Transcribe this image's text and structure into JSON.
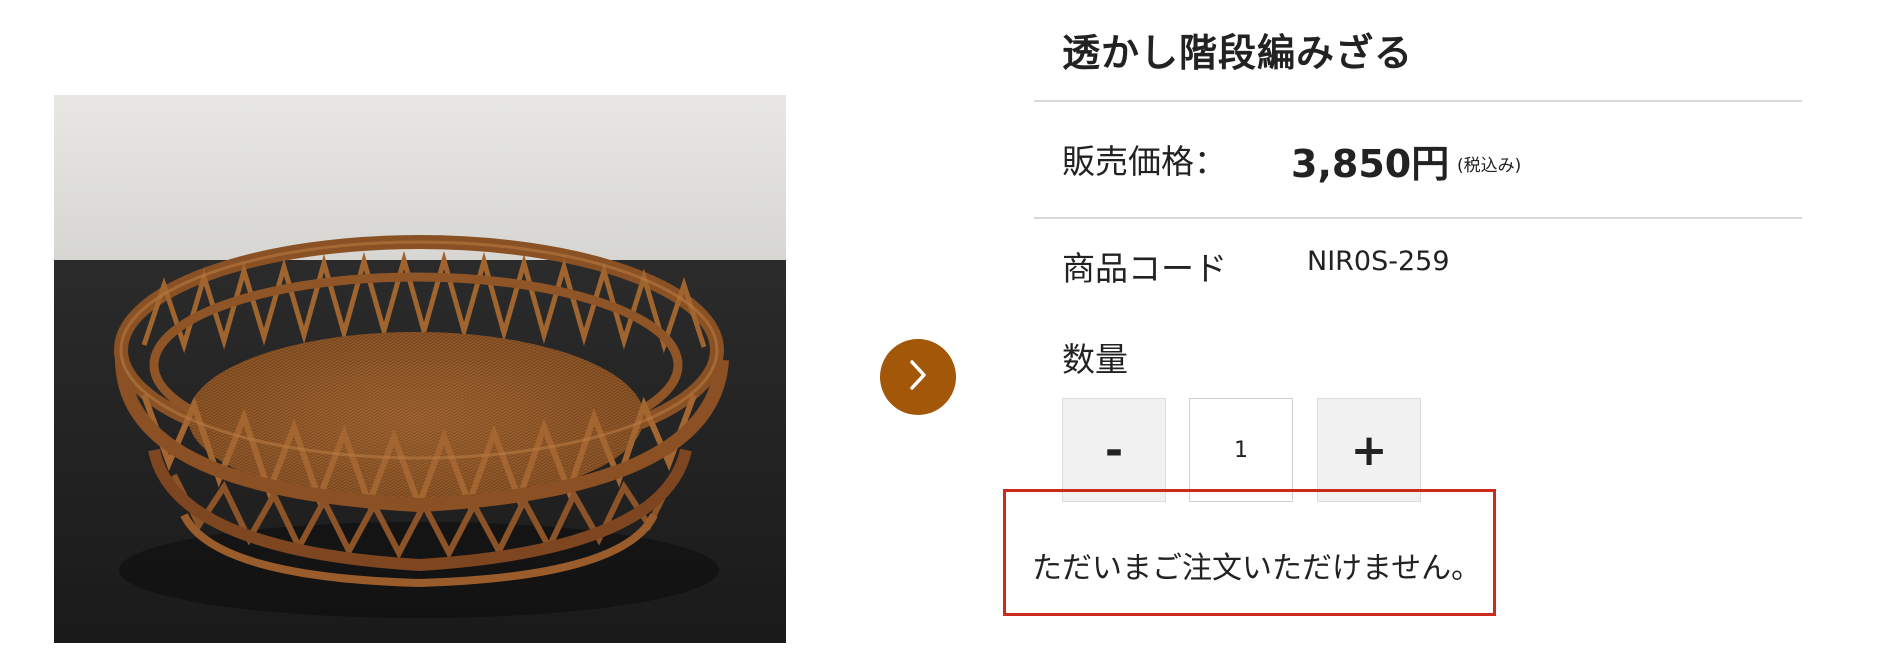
{
  "product": {
    "title": "透かし階段編みざる",
    "price_label": "販売価格：",
    "price_value": "3,850円",
    "price_tax_note": "(税込み)",
    "code_label": "商品コード",
    "code_value": "NIR0S-259",
    "quantity_label": "数量",
    "quantity_value": "1",
    "minus_label": "-",
    "plus_label": "+",
    "unavailable_message": "ただいまご注文いただけません。"
  },
  "gallery": {
    "next_icon": "chevron-right-icon"
  },
  "colors": {
    "accent_brown": "#a25709",
    "notice_border": "#cc2a1c",
    "divider": "#d9d9d9",
    "button_bg": "#f1f1f1"
  }
}
